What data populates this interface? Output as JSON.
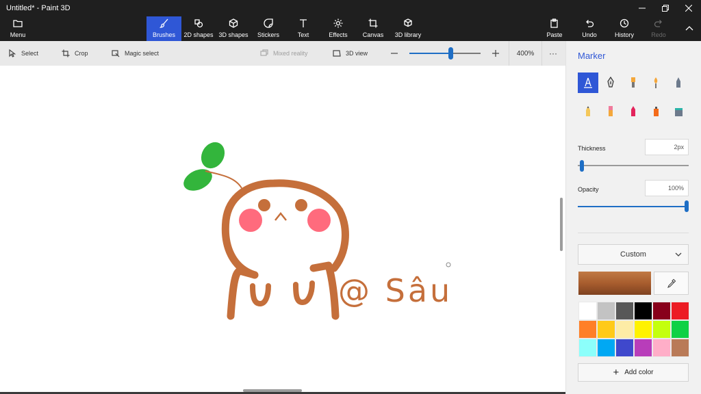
{
  "window": {
    "title": "Untitled* - Paint 3D"
  },
  "ribbon": {
    "menu": "Menu",
    "brushes": "Brushes",
    "shapes2d": "2D shapes",
    "shapes3d": "3D shapes",
    "stickers": "Stickers",
    "text": "Text",
    "effects": "Effects",
    "canvas": "Canvas",
    "library3d": "3D library",
    "paste": "Paste",
    "undo": "Undo",
    "history": "History",
    "redo": "Redo"
  },
  "toolbar": {
    "select": "Select",
    "crop": "Crop",
    "magic_select": "Magic select",
    "mixed_reality": "Mixed reality",
    "view3d": "3D view",
    "zoom": "400%",
    "zoom_level": 0.58
  },
  "drawing": {
    "text": "@ Sâu"
  },
  "panel": {
    "title": "Marker",
    "thickness_label": "Thickness",
    "thickness_value": "2px",
    "thickness_level": 0.02,
    "opacity_label": "Opacity",
    "opacity_value": "100%",
    "opacity_level": 1.0,
    "color_mode": "Custom",
    "current_color": "#a85d2e",
    "add_color": "Add color",
    "brushes": [
      {
        "name": "marker",
        "active": true
      },
      {
        "name": "calligraphy-pen"
      },
      {
        "name": "oil-brush"
      },
      {
        "name": "watercolor"
      },
      {
        "name": "pixel-pen"
      },
      {
        "name": "pencil"
      },
      {
        "name": "eraser"
      },
      {
        "name": "crayon"
      },
      {
        "name": "spray-can"
      },
      {
        "name": "fill-bucket"
      }
    ],
    "palette": [
      "#ffffff",
      "#c3c3c3",
      "#585858",
      "#000000",
      "#88001b",
      "#ec1c24",
      "#ff7f27",
      "#ffca18",
      "#fdeca6",
      "#fff200",
      "#c4ff0e",
      "#0ed145",
      "#8cfffb",
      "#00a8f3",
      "#3f48cc",
      "#b83dba",
      "#ffaec8",
      "#b97a57"
    ]
  }
}
